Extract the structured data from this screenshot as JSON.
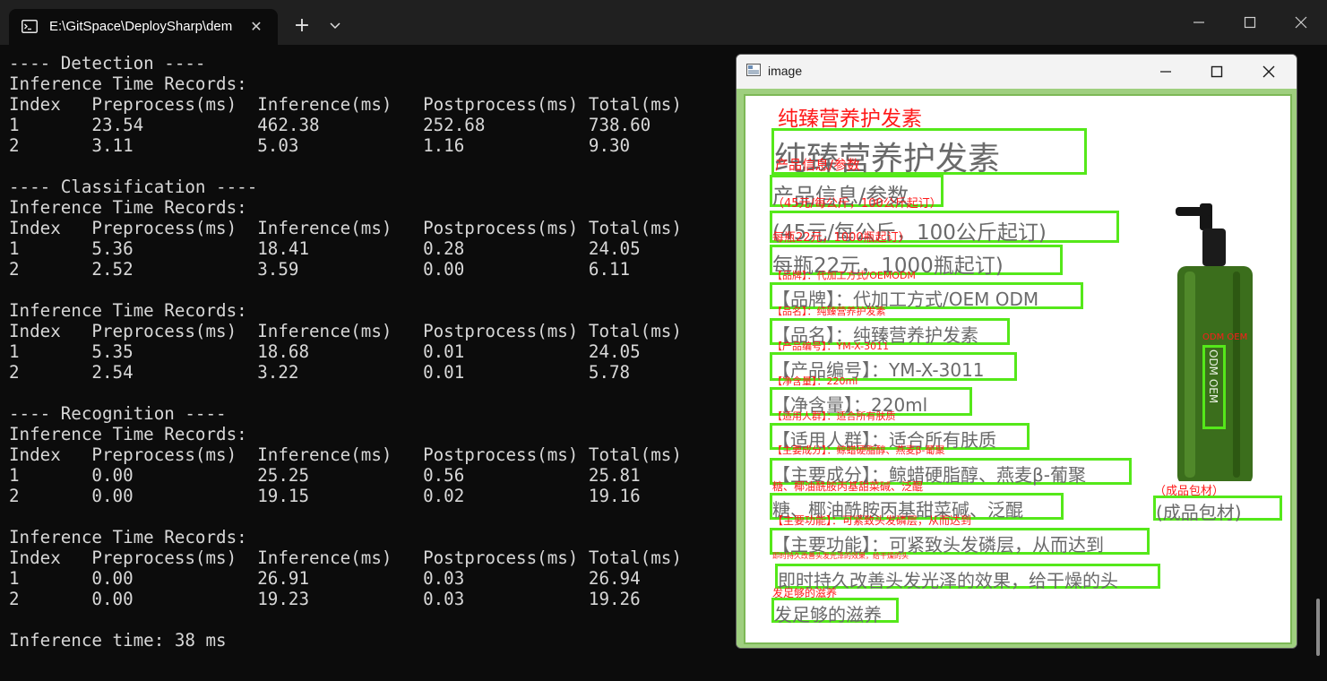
{
  "terminal": {
    "tab_title": "E:\\GitSpace\\DeploySharp\\dem",
    "icons": {
      "tab": "terminal-icon",
      "close": "close-icon",
      "new_tab": "plus-icon",
      "menu": "chevron-down-icon"
    },
    "lines": [
      "---- Detection ----",
      "Inference Time Records:",
      "Index   Preprocess(ms)  Inference(ms)   Postprocess(ms) Total(ms)",
      "1       23.54           462.38          252.68          738.60",
      "2       3.11            5.03            1.16            9.30",
      "",
      "---- Classification ----",
      "Inference Time Records:",
      "Index   Preprocess(ms)  Inference(ms)   Postprocess(ms) Total(ms)",
      "1       5.36            18.41           0.28            24.05",
      "2       2.52            3.59            0.00            6.11",
      "",
      "Inference Time Records:",
      "Index   Preprocess(ms)  Inference(ms)   Postprocess(ms) Total(ms)",
      "1       5.35            18.68           0.01            24.05",
      "2       2.54            3.22            0.01            5.78",
      "",
      "---- Recognition ----",
      "Inference Time Records:",
      "Index   Preprocess(ms)  Inference(ms)   Postprocess(ms) Total(ms)",
      "1       0.00            25.25           0.56            25.81",
      "2       0.00            19.15           0.02            19.16",
      "",
      "Inference Time Records:",
      "Index   Preprocess(ms)  Inference(ms)   Postprocess(ms) Total(ms)",
      "1       0.00            26.91           0.03            26.94",
      "2       0.00            19.23           0.03            19.26",
      "",
      "Inference time: 38 ms"
    ]
  },
  "image_window": {
    "title": "image",
    "colors": {
      "box": "#55e81a",
      "recognized_text": "#ff1a1a",
      "image_text": "#6a6a6a"
    },
    "ocr_items": [
      {
        "image_text": "纯臻营养护发素",
        "recognized": "纯臻营养护发素"
      },
      {
        "image_text": "产品信息/参数",
        "recognized": "产品信息/参数"
      },
      {
        "image_text": "(45元/每公斤，100公斤起订)",
        "recognized": "（45元/每公斤，100公斤起订）"
      },
      {
        "image_text": "每瓶22元，1000瓶起订)",
        "recognized": "每瓶22元，1000瓶起订）"
      },
      {
        "image_text": "【品牌】：代加工方式/OEM ODM",
        "recognized": "【品牌】：代加工方式/OEMODM"
      },
      {
        "image_text": "【品名】：纯臻营养护发素",
        "recognized": "【品名】：纯臻营养护发素"
      },
      {
        "image_text": "【产品编号】：YM-X-3011",
        "recognized": "【产品编号】：YM-X-3011"
      },
      {
        "image_text": "【净含量】：220ml",
        "recognized": "【净含量】：220ml"
      },
      {
        "image_text": "【适用人群】：适合所有肤质",
        "recognized": "【适用人群】：适合所有肤质"
      },
      {
        "image_text": "【主要成分】：鲸蜡硬脂醇、燕麦β-葡聚",
        "recognized": "【主要成分】：鲸蜡硬脂醇、燕麦β-葡聚"
      },
      {
        "image_text": "糖、椰油酰胺丙基甜菜碱、泛醌",
        "recognized": "糖、椰油酰胺丙基甜菜碱、泛醌"
      },
      {
        "image_text": "【主要功能】：可紧致头发磷层，从而达到",
        "recognized": "【主要功能】：可紧致头发磷层，从而达到"
      },
      {
        "image_text": "即时持久改善头发光泽的效果，给干燥的头",
        "recognized": "即时持久改善头发光泽的效果，给干燥的头"
      },
      {
        "image_text": "发足够的滋养",
        "recognized": "发足够的滋养"
      },
      {
        "image_text": "ODM OEM",
        "recognized": "ODM OEM"
      },
      {
        "image_text": "(成品包材)",
        "recognized": "（成品包材）"
      }
    ]
  }
}
